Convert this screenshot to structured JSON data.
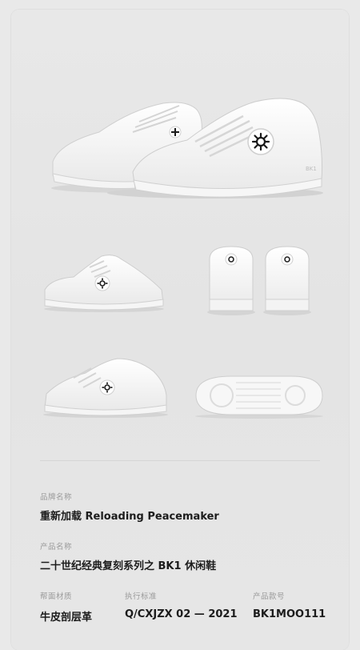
{
  "product": {
    "brand_label": "品牌名称",
    "brand_value": "重新加载  Reloading Peacemaker",
    "name_label": "产品名称",
    "name_value": "二十世纪经典复刻系列之 BK1 休闲鞋",
    "material_label": "帮面材质",
    "material_value": "牛皮剖层革",
    "standard_label": "执行标准",
    "standard_value": "Q/CXJZX 02 — 2021",
    "number_label": "产品款号",
    "number_value": "BK1MOO111"
  },
  "images": {
    "heel_tab_text": "BK1"
  },
  "colors": {
    "background": "#e9e9e9",
    "card": "#e6e6e6",
    "shoe_white": "#fafafa",
    "emblem": "#1a1a1a"
  }
}
